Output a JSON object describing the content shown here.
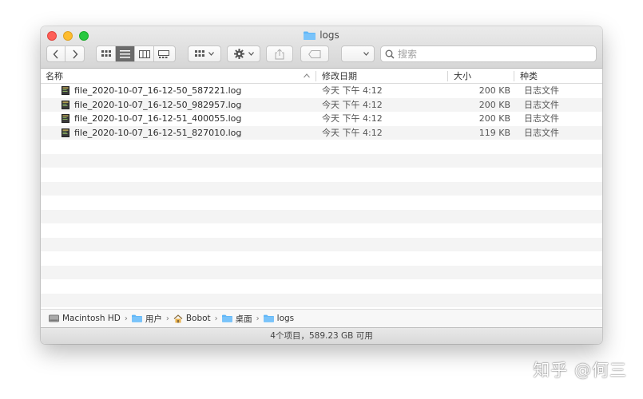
{
  "window": {
    "title": "logs",
    "accent": "#3b99fc"
  },
  "toolbar": {
    "back_icon": "chevron-left-icon",
    "forward_icon": "chevron-right-icon",
    "view_modes": [
      "icon-view",
      "list-view",
      "column-view",
      "gallery-view"
    ],
    "active_view": "list-view",
    "search_placeholder": "搜索"
  },
  "columns": {
    "name": "名称",
    "date": "修改日期",
    "size": "大小",
    "kind": "种类"
  },
  "files": [
    {
      "name": "file_2020-10-07_16-12-50_587221.log",
      "date": "今天 下午 4:12",
      "size": "200 KB",
      "kind": "日志文件"
    },
    {
      "name": "file_2020-10-07_16-12-50_982957.log",
      "date": "今天 下午 4:12",
      "size": "200 KB",
      "kind": "日志文件"
    },
    {
      "name": "file_2020-10-07_16-12-51_400055.log",
      "date": "今天 下午 4:12",
      "size": "200 KB",
      "kind": "日志文件"
    },
    {
      "name": "file_2020-10-07_16-12-51_827010.log",
      "date": "今天 下午 4:12",
      "size": "119 KB",
      "kind": "日志文件"
    }
  ],
  "pathbar": {
    "items": [
      "Macintosh HD",
      "用户",
      "Bobot",
      "桌面",
      "logs"
    ]
  },
  "status": {
    "text": "4个项目，589.23 GB 可用"
  },
  "watermark": {
    "text": "知乎 @何三"
  }
}
